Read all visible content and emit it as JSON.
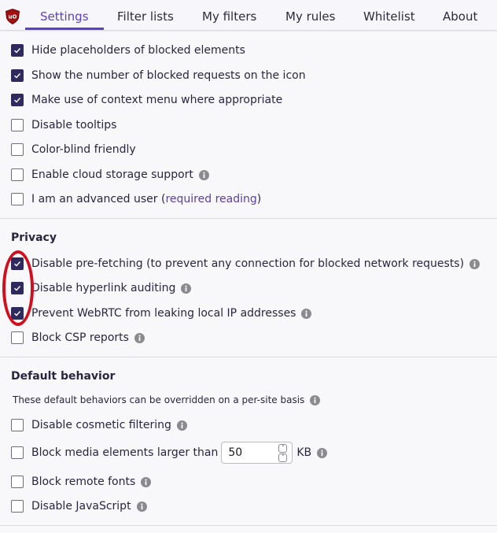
{
  "nav": {
    "logo": "ublock-origin-logo",
    "tabs": [
      {
        "label": "Settings",
        "active": true
      },
      {
        "label": "Filter lists",
        "active": false
      },
      {
        "label": "My filters",
        "active": false
      },
      {
        "label": "My rules",
        "active": false
      },
      {
        "label": "Whitelist",
        "active": false
      },
      {
        "label": "About",
        "active": false
      }
    ]
  },
  "appearance": {
    "items": [
      {
        "label": "Hide placeholders of blocked elements",
        "checked": true,
        "info": false
      },
      {
        "label": "Show the number of blocked requests on the icon",
        "checked": true,
        "info": false
      },
      {
        "label": "Make use of context menu where appropriate",
        "checked": true,
        "info": false
      },
      {
        "label": "Disable tooltips",
        "checked": false,
        "info": false
      },
      {
        "label": "Color-blind friendly",
        "checked": false,
        "info": false
      },
      {
        "label": "Enable cloud storage support",
        "checked": false,
        "info": true
      },
      {
        "label_prefix": "I am an advanced user (",
        "link": "required reading",
        "label_suffix": ")",
        "checked": false,
        "info": false
      }
    ]
  },
  "privacy": {
    "title": "Privacy",
    "items": [
      {
        "label": "Disable pre-fetching (to prevent any connection for blocked network requests)",
        "checked": true,
        "info": true
      },
      {
        "label": "Disable hyperlink auditing",
        "checked": true,
        "info": true
      },
      {
        "label": "Prevent WebRTC from leaking local IP addresses",
        "checked": true,
        "info": true
      },
      {
        "label": "Block CSP reports",
        "checked": false,
        "info": true
      }
    ]
  },
  "default_behavior": {
    "title": "Default behavior",
    "note": "These default behaviors can be overridden on a per-site basis",
    "items": [
      {
        "label": "Disable cosmetic filtering",
        "checked": false,
        "info": true
      },
      {
        "label": "Block media elements larger than",
        "checked": false,
        "info": true,
        "value": "50",
        "unit": "KB"
      },
      {
        "label": "Block remote fonts",
        "checked": false,
        "info": true
      },
      {
        "label": "Disable JavaScript",
        "checked": false,
        "info": true
      }
    ]
  },
  "annotation": {
    "shape": "red-ellipse",
    "color": "#d0101f",
    "highlights": "privacy-checkboxes"
  },
  "colors": {
    "accent": "#5b40c8",
    "checkbox": "#2e2a5e",
    "link": "#5b40a8",
    "logo": "#800000"
  }
}
